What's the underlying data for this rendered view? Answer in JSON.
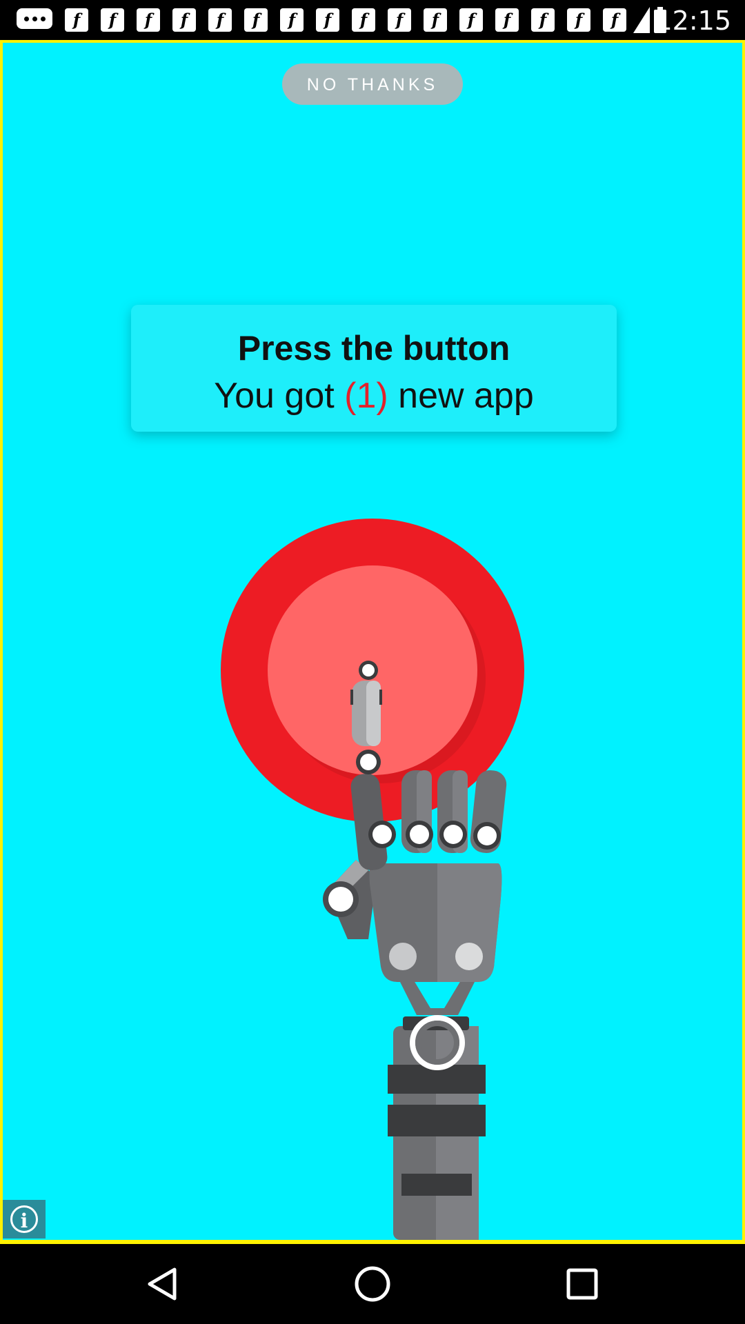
{
  "status_bar": {
    "time": "12:15",
    "icons": [
      "more-dots-icon",
      "notification-app-icon",
      "notification-app-icon",
      "notification-app-icon",
      "notification-app-icon",
      "notification-app-icon",
      "notification-app-icon",
      "notification-app-icon",
      "notification-app-icon",
      "notification-app-icon",
      "notification-app-icon",
      "notification-app-icon",
      "notification-app-icon",
      "notification-app-icon",
      "notification-app-icon",
      "notification-app-icon",
      "notification-app-icon"
    ],
    "notification_glyph": "f"
  },
  "ad": {
    "no_thanks_label": "NO THANKS",
    "card_title": "Press the button",
    "card_sub_prefix": "You got ",
    "card_sub_count": "(1)",
    "card_sub_suffix": " new app",
    "info_glyph": "i",
    "colors": {
      "background": "#00F2FF",
      "frame": "#FFF200",
      "button_outer": "#ED1C24",
      "button_inner": "#FF6666",
      "highlight": "#E3212B"
    }
  },
  "nav_bar": {
    "icons": [
      "back-icon",
      "home-icon",
      "recents-icon"
    ]
  }
}
